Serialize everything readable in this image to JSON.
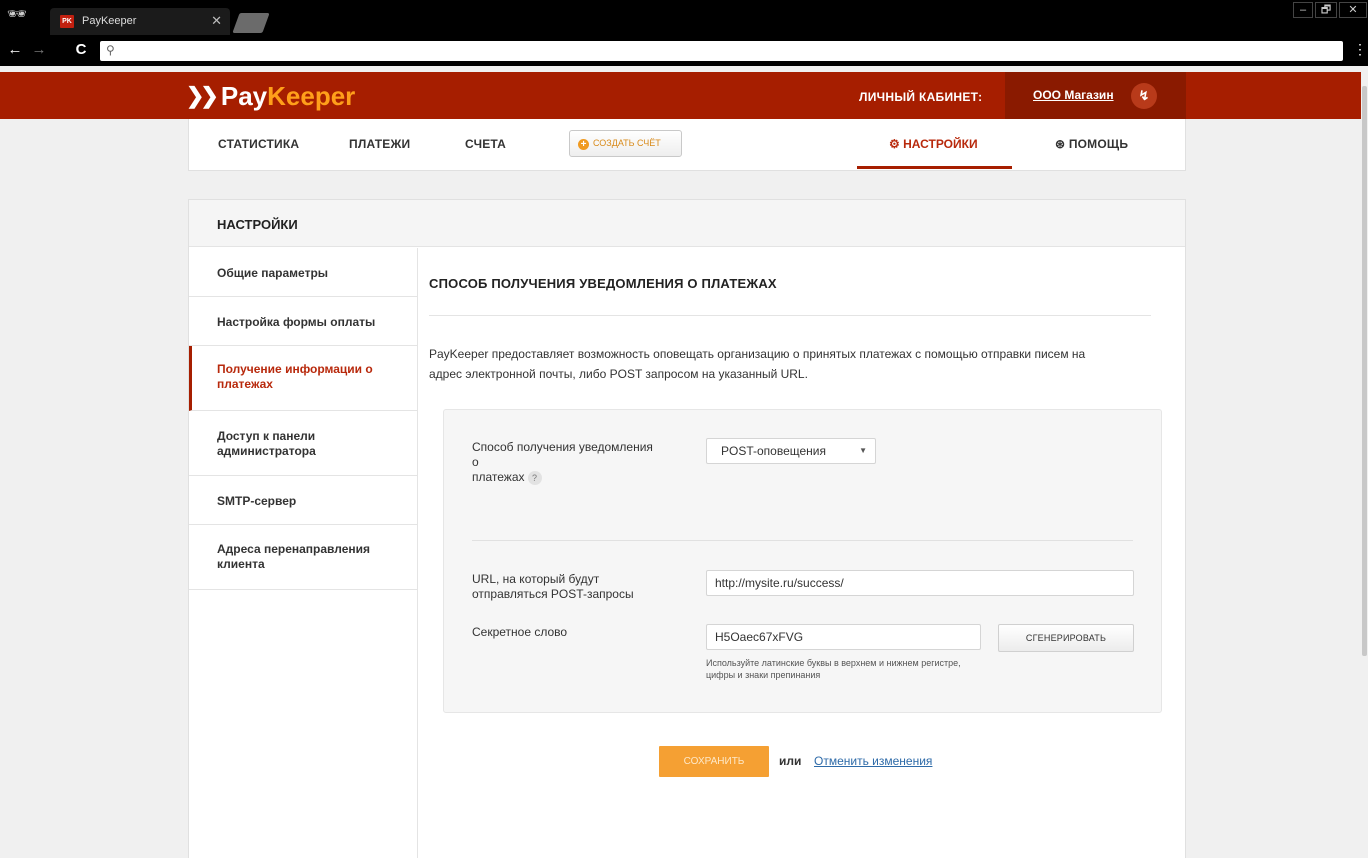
{
  "browser": {
    "tab_title": "PayKeeper",
    "tab_favicon": "PK",
    "window_controls": [
      "–",
      "🗗",
      "✕"
    ]
  },
  "header": {
    "logo_pay": "Pay",
    "logo_keeper": "Keeper",
    "cabinet_label": "ЛИЧНЫЙ КАБИНЕТ:",
    "cabinet_name": "ООО Магазин"
  },
  "menu": {
    "stats": "СТАТИСТИКА",
    "payments": "ПЛАТЕЖИ",
    "invoices": "СЧЕТА",
    "create_invoice": "СОЗДАТЬ СЧЁТ",
    "settings": "НАСТРОЙКИ",
    "help": "ПОМОЩЬ"
  },
  "panel": {
    "title": "НАСТРОЙКИ"
  },
  "sidebar": {
    "items": [
      {
        "label": "Общие параметры"
      },
      {
        "label": "Настройка формы оплаты"
      },
      {
        "label": "Получение информации о платежах",
        "active": true
      },
      {
        "label": "Доступ к панели администратора"
      },
      {
        "label": "SMTP-сервер"
      },
      {
        "label": "Адреса перенаправления клиента"
      }
    ]
  },
  "content": {
    "title": "СПОСОБ ПОЛУЧЕНИЯ УВЕДОМЛЕНИЯ О ПЛАТЕЖАХ",
    "description": "PayKeeper предоставляет возможность оповещать организацию о принятых платежах с помощью отправки писем на адрес электронной почты, либо POST запросом на указанный URL.",
    "method_label_1": "Способ получения уведомления",
    "method_label_2": "о",
    "method_label_3": "платежах",
    "help_mark": "?",
    "method_value": "POST-оповещения",
    "url_label_1": "URL, на который будут",
    "url_label_2": "отправляться POST-запросы",
    "url_value": "http://mysite.ru/success/",
    "secret_label": "Секретное слово",
    "secret_value": "H5Oaec67xFVG",
    "generate_button": "СГЕНЕРИРОВАТЬ",
    "hint": "Используйте латинские буквы в верхнем и нижнем регистре, цифры и знаки препинания",
    "save_button": "СОХРАНИТЬ",
    "or_text": "или",
    "cancel_link": "Отменить изменения"
  },
  "colors": {
    "brand_red": "#a61e00",
    "brand_orange": "#f5a033",
    "link_blue": "#2d6aa8"
  }
}
